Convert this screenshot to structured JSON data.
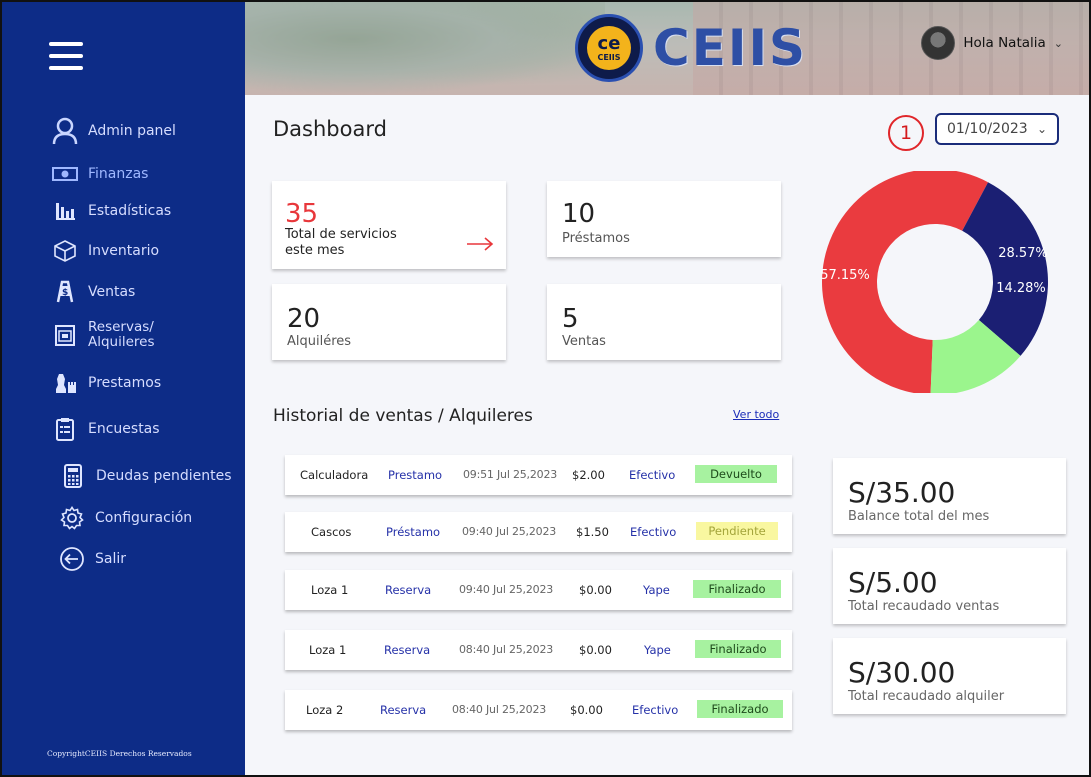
{
  "sidebar": {
    "items": [
      {
        "label": "Admin panel",
        "icon": "user-icon"
      },
      {
        "label": "Finanzas",
        "icon": "money-icon"
      },
      {
        "label": "Estadísticas",
        "icon": "bar-chart-icon"
      },
      {
        "label": "Inventario",
        "icon": "box-icon"
      },
      {
        "label": "Ventas",
        "icon": "ventas-icon"
      },
      {
        "label": "Reservas/\nAlquileres",
        "icon": "calendar-icon"
      },
      {
        "label": "Prestamos",
        "icon": "chess-icon"
      },
      {
        "label": "Encuestas",
        "icon": "clipboard-icon"
      },
      {
        "label": "Deudas pendientes",
        "icon": "calculator-icon"
      },
      {
        "label": "Configuración",
        "icon": "gear-icon"
      },
      {
        "label": "Salir",
        "icon": "logout-icon"
      }
    ],
    "copyright": "CopyrightCEIIS Derechos Reservados"
  },
  "header": {
    "logo_text": "CEIIS",
    "badge_big": "ce",
    "badge_small": "CEIIS",
    "user_greeting": "Hola Natalia"
  },
  "dashboard": {
    "title": "Dashboard",
    "step_number": "1",
    "date_selected": "01/10/2023",
    "stats": [
      {
        "value": "35",
        "label": "Total de servicios\neste mes"
      },
      {
        "value": "10",
        "label": "Préstamos"
      },
      {
        "value": "20",
        "label": "Alquiléres"
      },
      {
        "value": "5",
        "label": "Ventas"
      }
    ]
  },
  "history": {
    "title": "Historial de ventas / Alquileres",
    "view_all": "Ver todo",
    "rows": [
      {
        "item": "Calculadora",
        "type": "Prestamo",
        "date": "09:51 Jul 25,2023",
        "amount": "$2.00",
        "payment": "Efectivo",
        "status": "Devuelto"
      },
      {
        "item": "Cascos",
        "type": "Préstamo",
        "date": "09:40 Jul 25,2023",
        "amount": "$1.50",
        "payment": "Efectivo",
        "status": "Pendiente"
      },
      {
        "item": "Loza 1",
        "type": "Reserva",
        "date": "09:40 Jul 25,2023",
        "amount": "$0.00",
        "payment": "Yape",
        "status": "Finalizado"
      },
      {
        "item": "Loza 1",
        "type": "Reserva",
        "date": "08:40 Jul 25,2023",
        "amount": "$0.00",
        "payment": "Yape",
        "status": "Finalizado"
      },
      {
        "item": "Loza 2",
        "type": "Reserva",
        "date": "08:40 Jul 25,2023",
        "amount": "$0.00",
        "payment": "Efectivo",
        "status": "Finalizado"
      }
    ]
  },
  "balances": [
    {
      "value": "S/35.00",
      "label": "Balance total del mes"
    },
    {
      "value": "S/5.00",
      "label": "Total recaudado ventas"
    },
    {
      "value": "S/30.00",
      "label": "Total recaudado alquiler"
    }
  ],
  "chart_data": {
    "type": "pie",
    "donut": true,
    "slices": [
      {
        "label": "57.15%",
        "value": 57.15,
        "color": "#ea3b3f"
      },
      {
        "label": "28.57%",
        "value": 28.57,
        "color": "#1b1f73"
      },
      {
        "label": "14.28%",
        "value": 14.28,
        "color": "#9bf58d"
      }
    ]
  },
  "colors": {
    "sidebar": "#0d2c87",
    "accent_red": "#e8373b",
    "link_blue": "#2531a8",
    "status_green": "#a7f2a0",
    "status_yellow": "#f9f7a0"
  }
}
